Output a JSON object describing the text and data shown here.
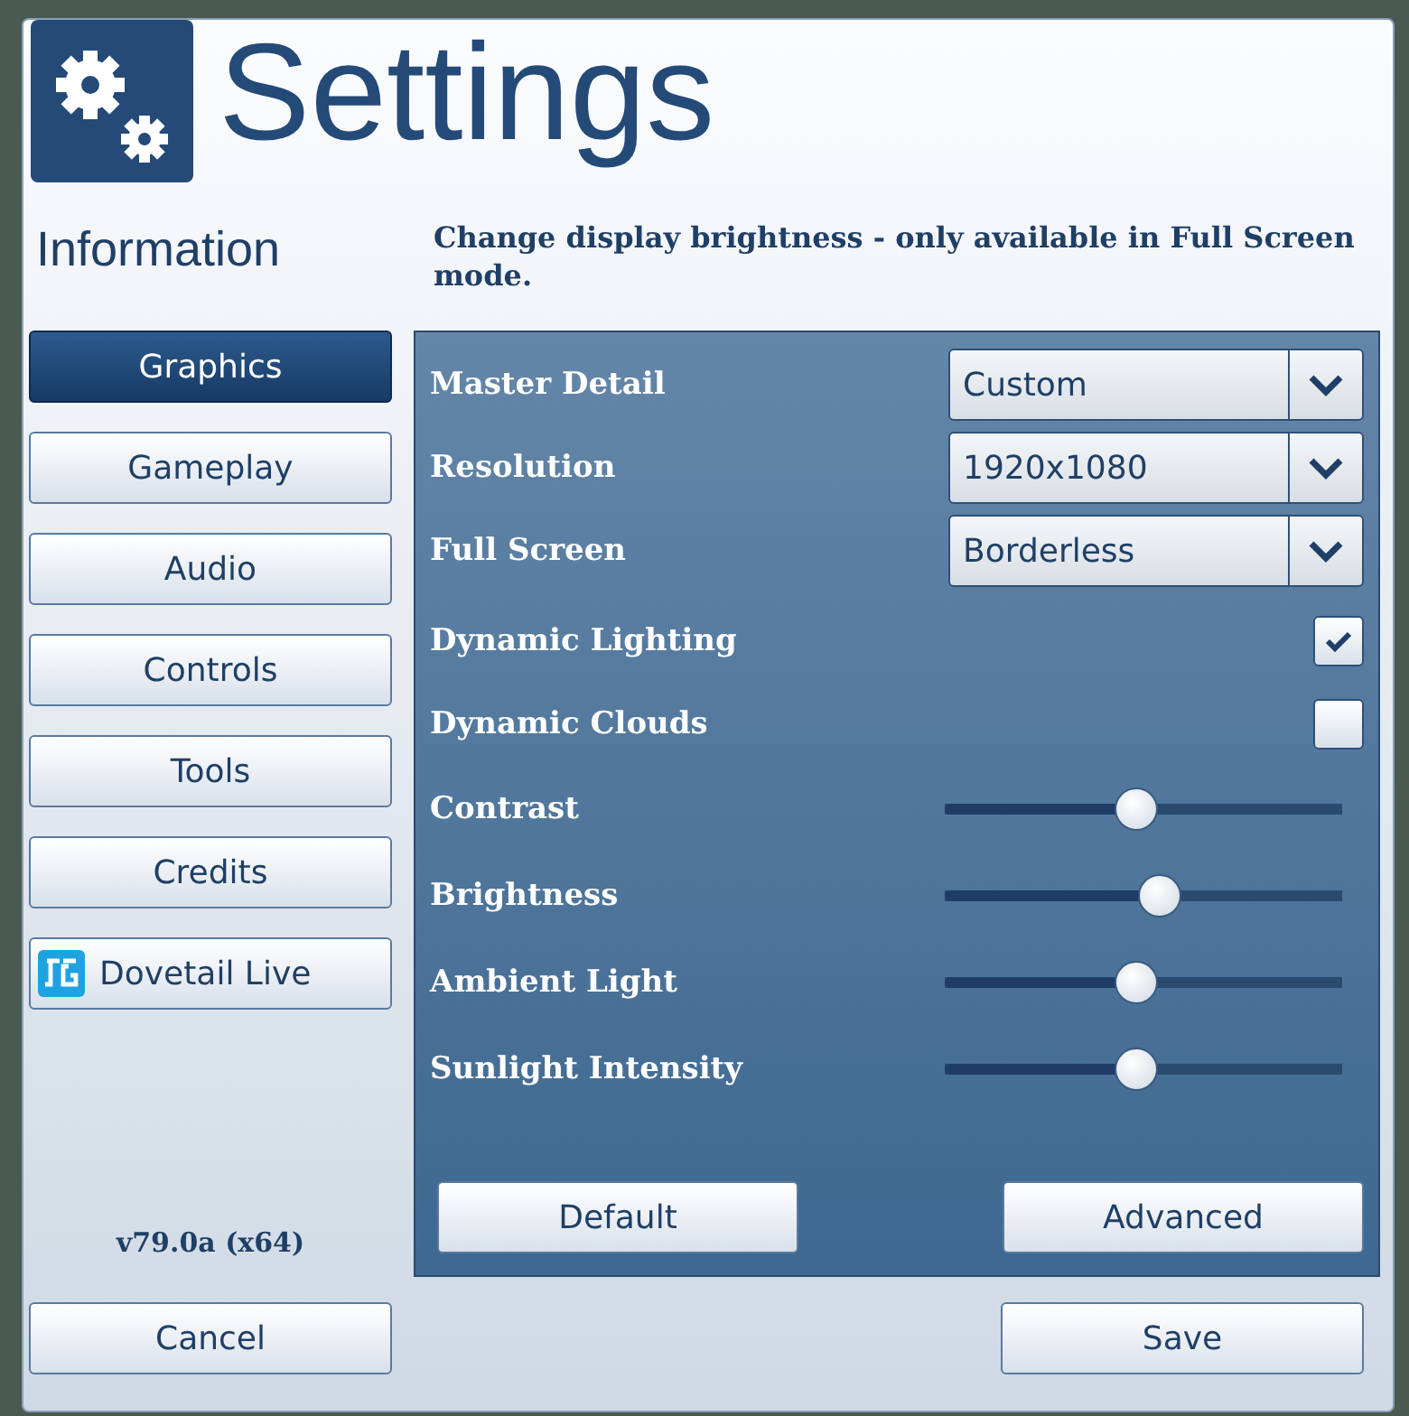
{
  "window": {
    "title": "Settings"
  },
  "section_title": "Information",
  "description": "Change display brightness - only available in Full Screen mode.",
  "nav": [
    {
      "label": "Graphics",
      "selected": true
    },
    {
      "label": "Gameplay",
      "selected": false
    },
    {
      "label": "Audio",
      "selected": false
    },
    {
      "label": "Controls",
      "selected": false
    },
    {
      "label": "Tools",
      "selected": false
    },
    {
      "label": "Credits",
      "selected": false
    },
    {
      "label": "Dovetail Live",
      "selected": false,
      "kind": "app"
    }
  ],
  "version": "v79.0a (x64)",
  "settings": [
    {
      "kind": "dropdown",
      "label": "Master Detail",
      "value": "Custom"
    },
    {
      "kind": "dropdown",
      "label": "Resolution",
      "value": "1920x1080"
    },
    {
      "kind": "dropdown",
      "label": "Full Screen",
      "value": "Borderless"
    },
    {
      "kind": "checkbox",
      "label": "Dynamic Lighting",
      "checked": true
    },
    {
      "kind": "checkbox",
      "label": "Dynamic Clouds",
      "checked": false
    },
    {
      "kind": "slider",
      "label": "Contrast",
      "level": 0.48
    },
    {
      "kind": "slider",
      "label": "Brightness",
      "level": 0.54
    },
    {
      "kind": "slider",
      "label": "Ambient Light",
      "level": 0.48
    },
    {
      "kind": "slider",
      "label": "Sunlight Intensity",
      "level": 0.48
    }
  ],
  "panel_buttons": [
    "Default",
    "Advanced"
  ],
  "footer_buttons": [
    "Cancel",
    "Save"
  ]
}
